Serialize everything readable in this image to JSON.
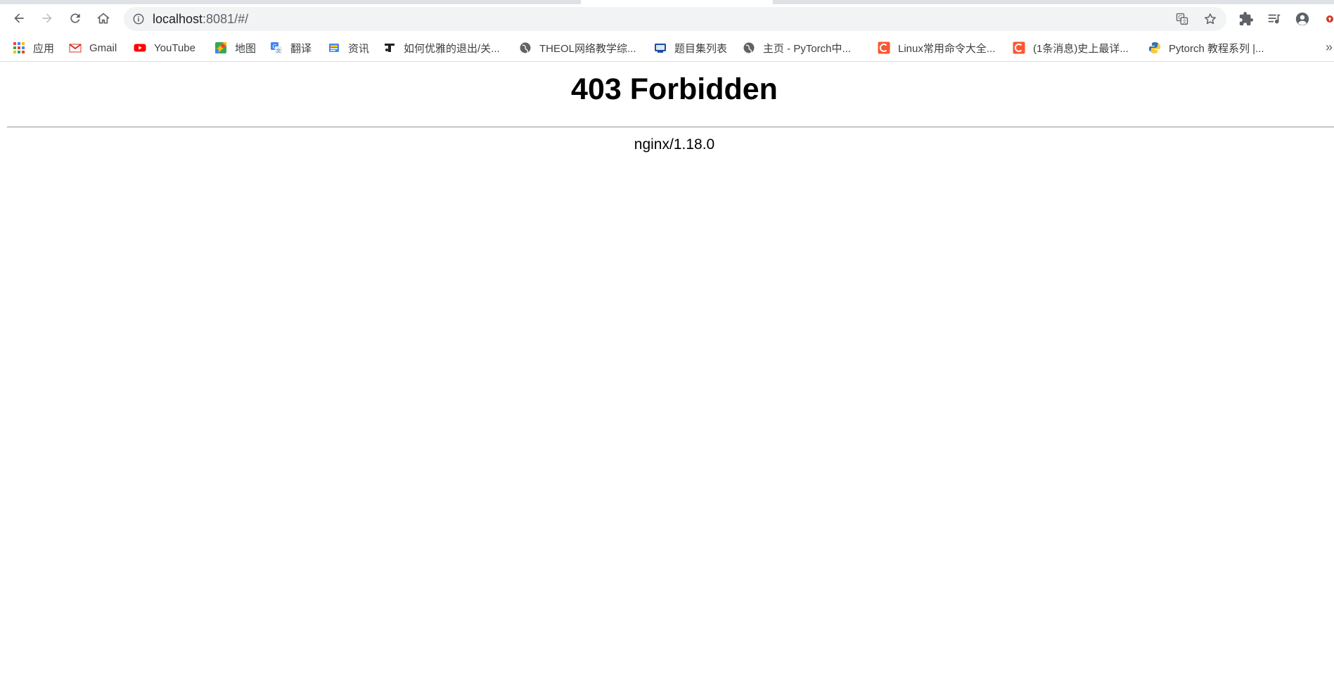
{
  "browser": {
    "url_host": "localhost",
    "url_rest": ":8081/#/",
    "bookmarks": [
      {
        "label": "应用",
        "icon": "apps-grid-icon"
      },
      {
        "label": "Gmail",
        "icon": "gmail-icon"
      },
      {
        "label": "YouTube",
        "icon": "youtube-icon"
      },
      {
        "label": "地图",
        "icon": "maps-icon"
      },
      {
        "label": "翻译",
        "icon": "translate-icon"
      },
      {
        "label": "资讯",
        "icon": "news-icon"
      },
      {
        "label": "如何优雅的退出/关...",
        "icon": "site-icon"
      },
      {
        "label": "THEOL网络教学综...",
        "icon": "globe-icon"
      },
      {
        "label": "题目集列表",
        "icon": "site-icon"
      },
      {
        "label": "主页 - PyTorch中...",
        "icon": "globe-icon"
      },
      {
        "label": "Linux常用命令大全...",
        "icon": "csdn-icon"
      },
      {
        "label": "(1条消息)史上最详...",
        "icon": "csdn-icon"
      },
      {
        "label": "Pytorch 教程系列 |...",
        "icon": "python-icon"
      }
    ],
    "more_bookmarks": "»"
  },
  "page": {
    "title": "403 Forbidden",
    "server": "nginx/1.18.0"
  },
  "colors": {
    "csdn": "#fc5531",
    "youtube": "#ff0000",
    "gmail": "#d93025",
    "text": "#3c4043"
  }
}
